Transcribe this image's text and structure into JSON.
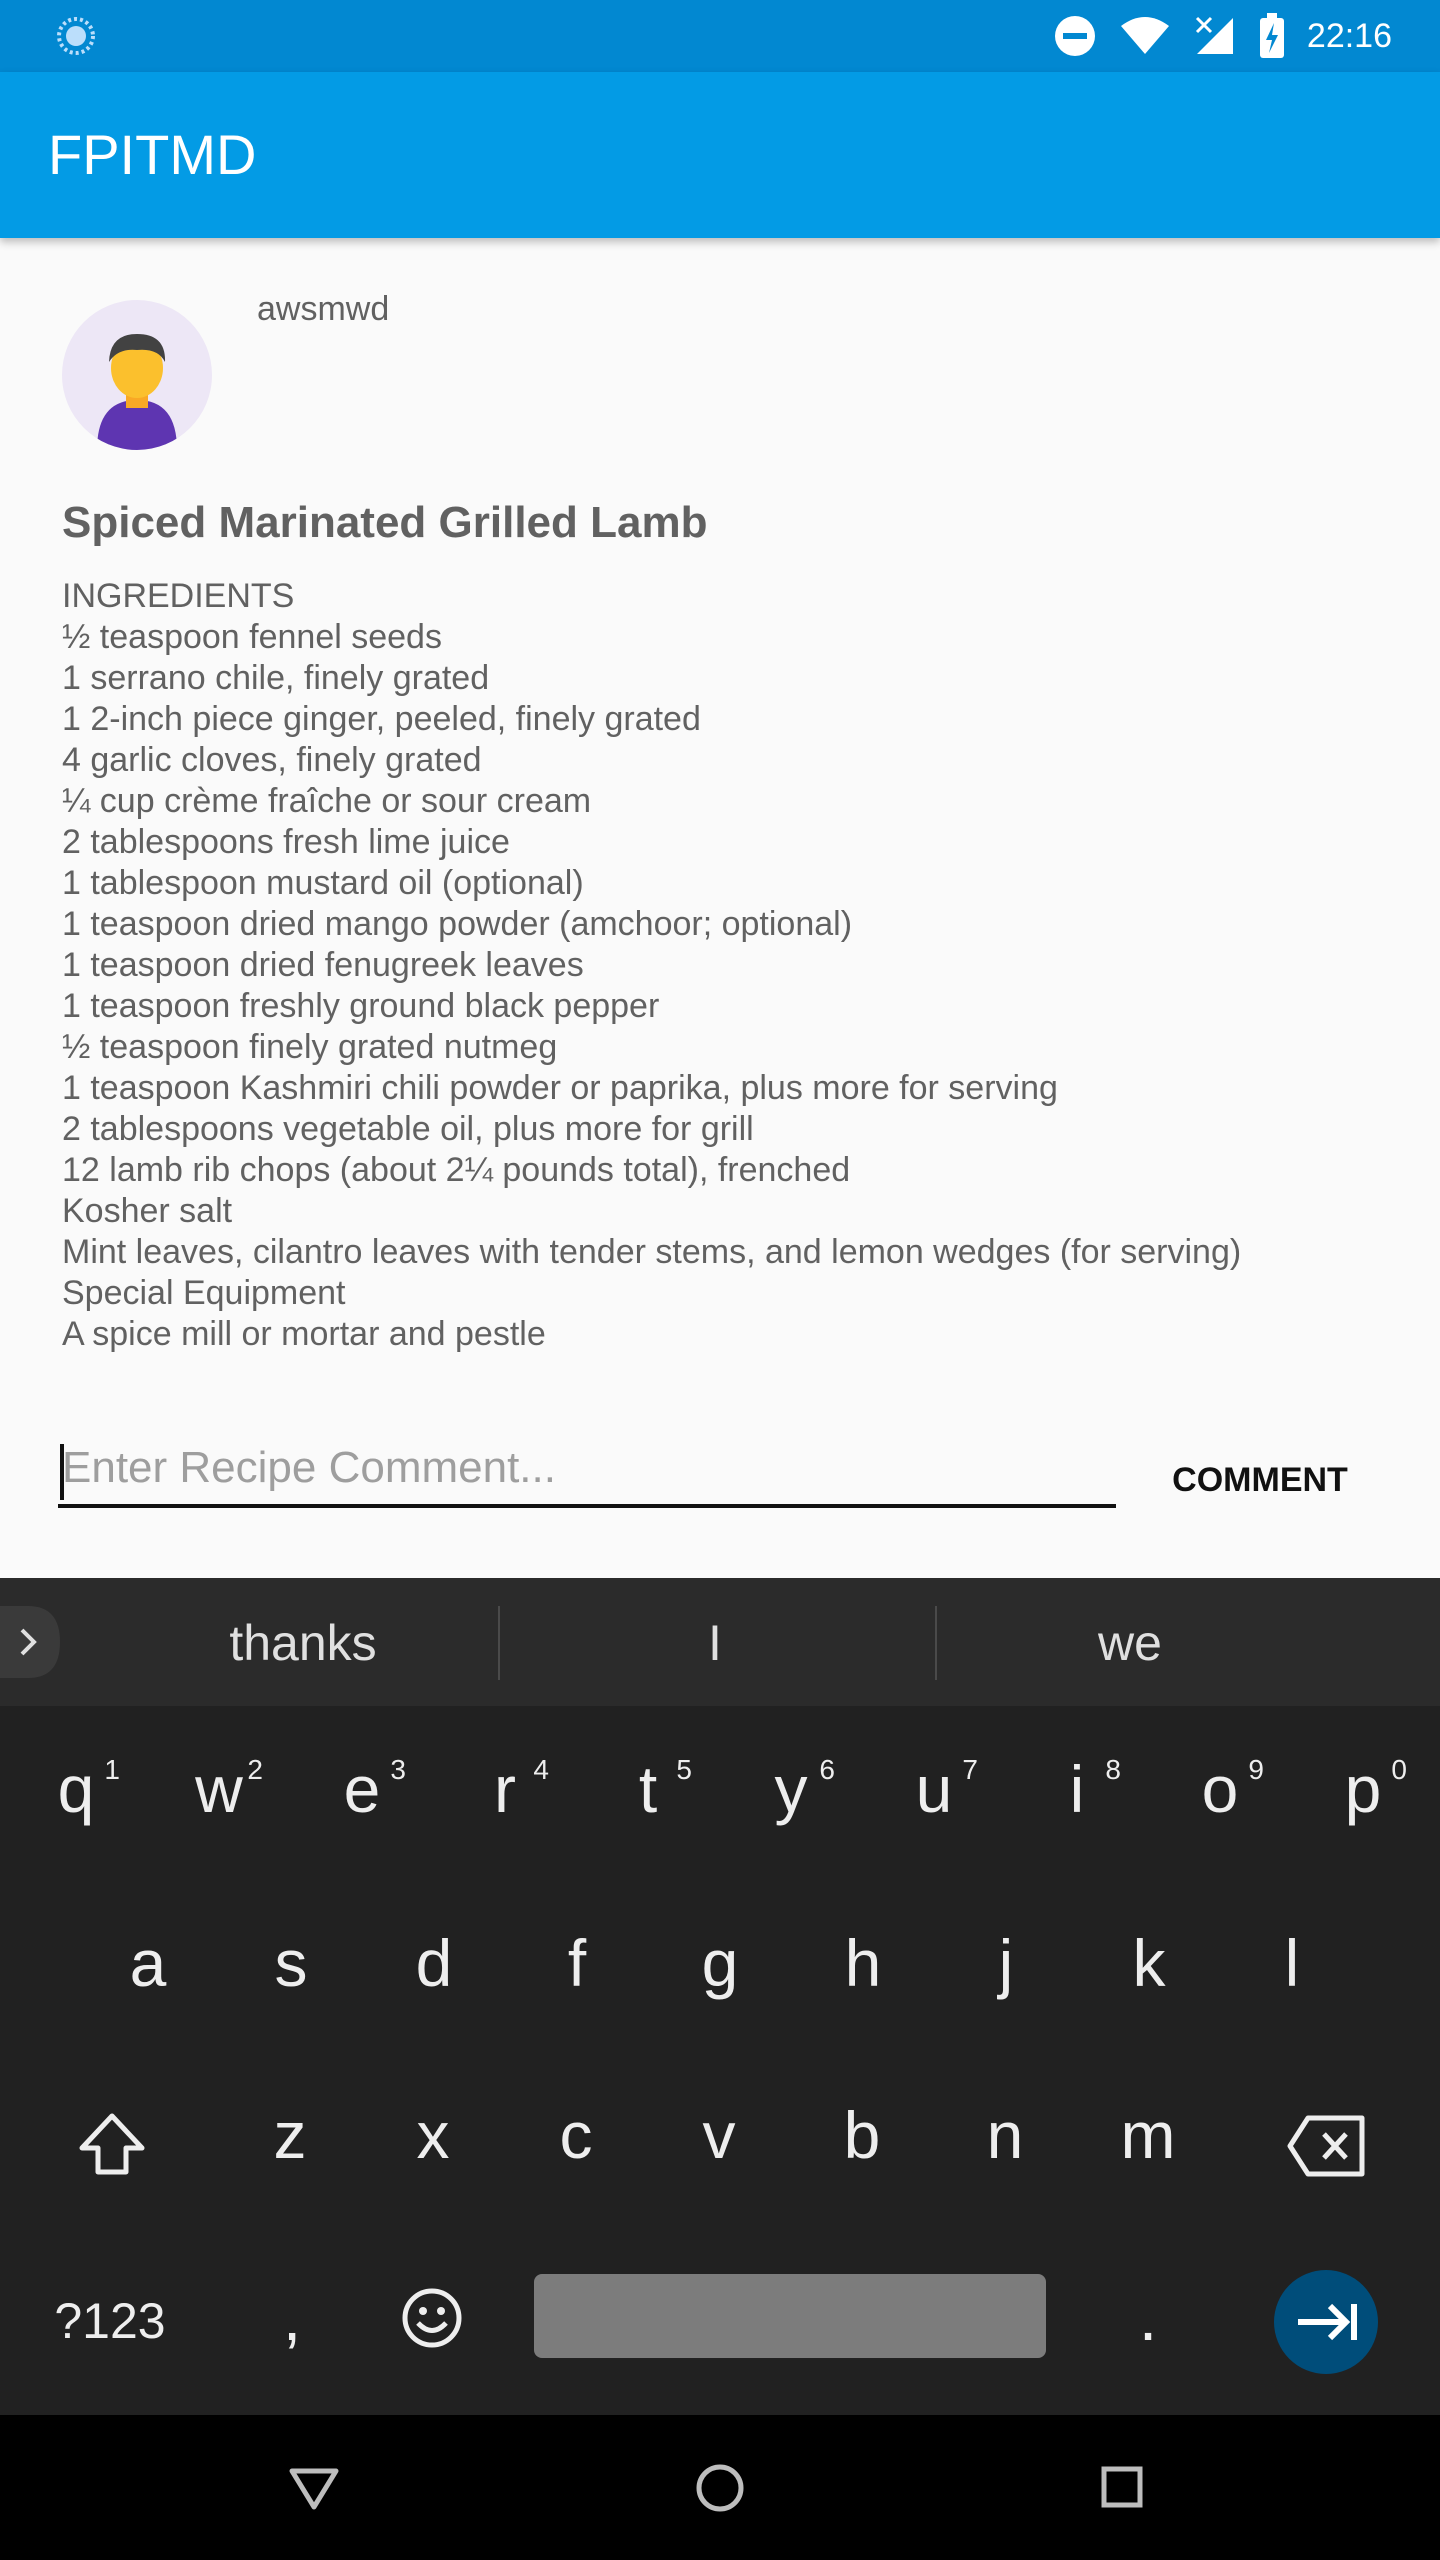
{
  "status_bar": {
    "time": "22:16",
    "icons": [
      "loading-icon",
      "do-not-disturb-icon",
      "wifi-icon",
      "signal-no-data-icon",
      "battery-charging-icon"
    ]
  },
  "app_bar": {
    "title": "FPITMD"
  },
  "post": {
    "username": "awsmwd",
    "avatar": "person-avatar-icon",
    "recipe_title": "Spiced Marinated Grilled Lamb",
    "ingredients": [
      "INGREDIENTS",
      "½ teaspoon fennel seeds",
      "1 serrano chile, finely grated",
      "1 2-inch piece ginger, peeled, finely grated",
      "4 garlic cloves, finely grated",
      "¼ cup crème fraîche or sour cream",
      "2 tablespoons fresh lime juice",
      "1 tablespoon mustard oil (optional)",
      "1 teaspoon dried mango powder (amchoor; optional)",
      "1 teaspoon dried fenugreek leaves",
      "1 teaspoon freshly ground black pepper",
      "½ teaspoon finely grated nutmeg",
      "1 teaspoon Kashmiri chili powder or paprika, plus more for serving",
      "2 tablespoons vegetable oil, plus more for grill",
      "12 lamb rib chops (about 2¼ pounds total), frenched",
      "Kosher salt",
      "Mint leaves, cilantro leaves with tender stems, and lemon wedges (for serving)",
      "Special Equipment",
      "A spice mill or mortar and pestle"
    ]
  },
  "comment": {
    "placeholder": "Enter Recipe Comment...",
    "value": "",
    "button_label": "COMMENT"
  },
  "keyboard": {
    "suggestions": [
      "thanks",
      "I",
      "we"
    ],
    "row1": [
      {
        "ch": "q",
        "num": "1"
      },
      {
        "ch": "w",
        "num": "2"
      },
      {
        "ch": "e",
        "num": "3"
      },
      {
        "ch": "r",
        "num": "4"
      },
      {
        "ch": "t",
        "num": "5"
      },
      {
        "ch": "y",
        "num": "6"
      },
      {
        "ch": "u",
        "num": "7"
      },
      {
        "ch": "i",
        "num": "8"
      },
      {
        "ch": "o",
        "num": "9"
      },
      {
        "ch": "p",
        "num": "0"
      }
    ],
    "row2": [
      "a",
      "s",
      "d",
      "f",
      "g",
      "h",
      "j",
      "k",
      "l"
    ],
    "row3": [
      "z",
      "x",
      "c",
      "v",
      "b",
      "n",
      "m"
    ],
    "symbols_label": "?123",
    "comma": ",",
    "period": "."
  },
  "nav_bar": {
    "icons": [
      "back-triangle-icon",
      "home-circle-icon",
      "recents-square-icon"
    ]
  }
}
